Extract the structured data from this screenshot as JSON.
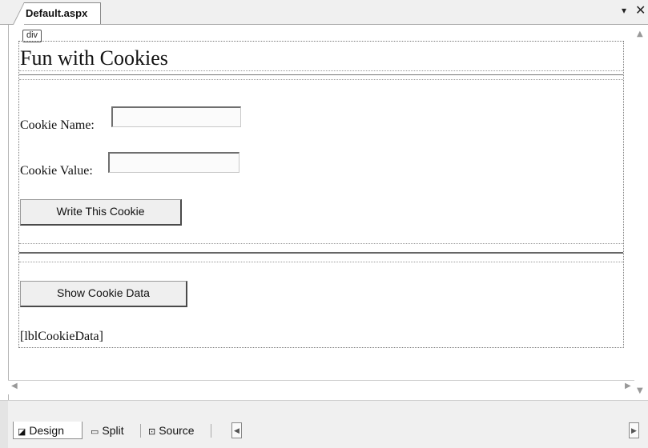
{
  "tab": {
    "title": "Default.aspx",
    "dropdown_glyph": "▾",
    "close_glyph": "✕"
  },
  "design": {
    "div_tag": "div",
    "heading": "Fun with Cookies",
    "cookie_name_label": "Cookie Name:",
    "cookie_value_label": "Cookie Value:",
    "cookie_name_value": "",
    "cookie_value_value": "",
    "write_button": "Write This Cookie",
    "show_button": "Show Cookie Data",
    "label_placeholder": "[lblCookieData]"
  },
  "scrollbars": {
    "up": "▲",
    "down": "▼",
    "left": "◀",
    "right": "▶"
  },
  "views": {
    "design": {
      "label": "Design",
      "icon": "design-view-icon"
    },
    "split": {
      "label": "Split",
      "icon": "split-view-icon"
    },
    "source": {
      "label": "Source",
      "icon": "source-view-icon"
    },
    "active": "Design"
  }
}
